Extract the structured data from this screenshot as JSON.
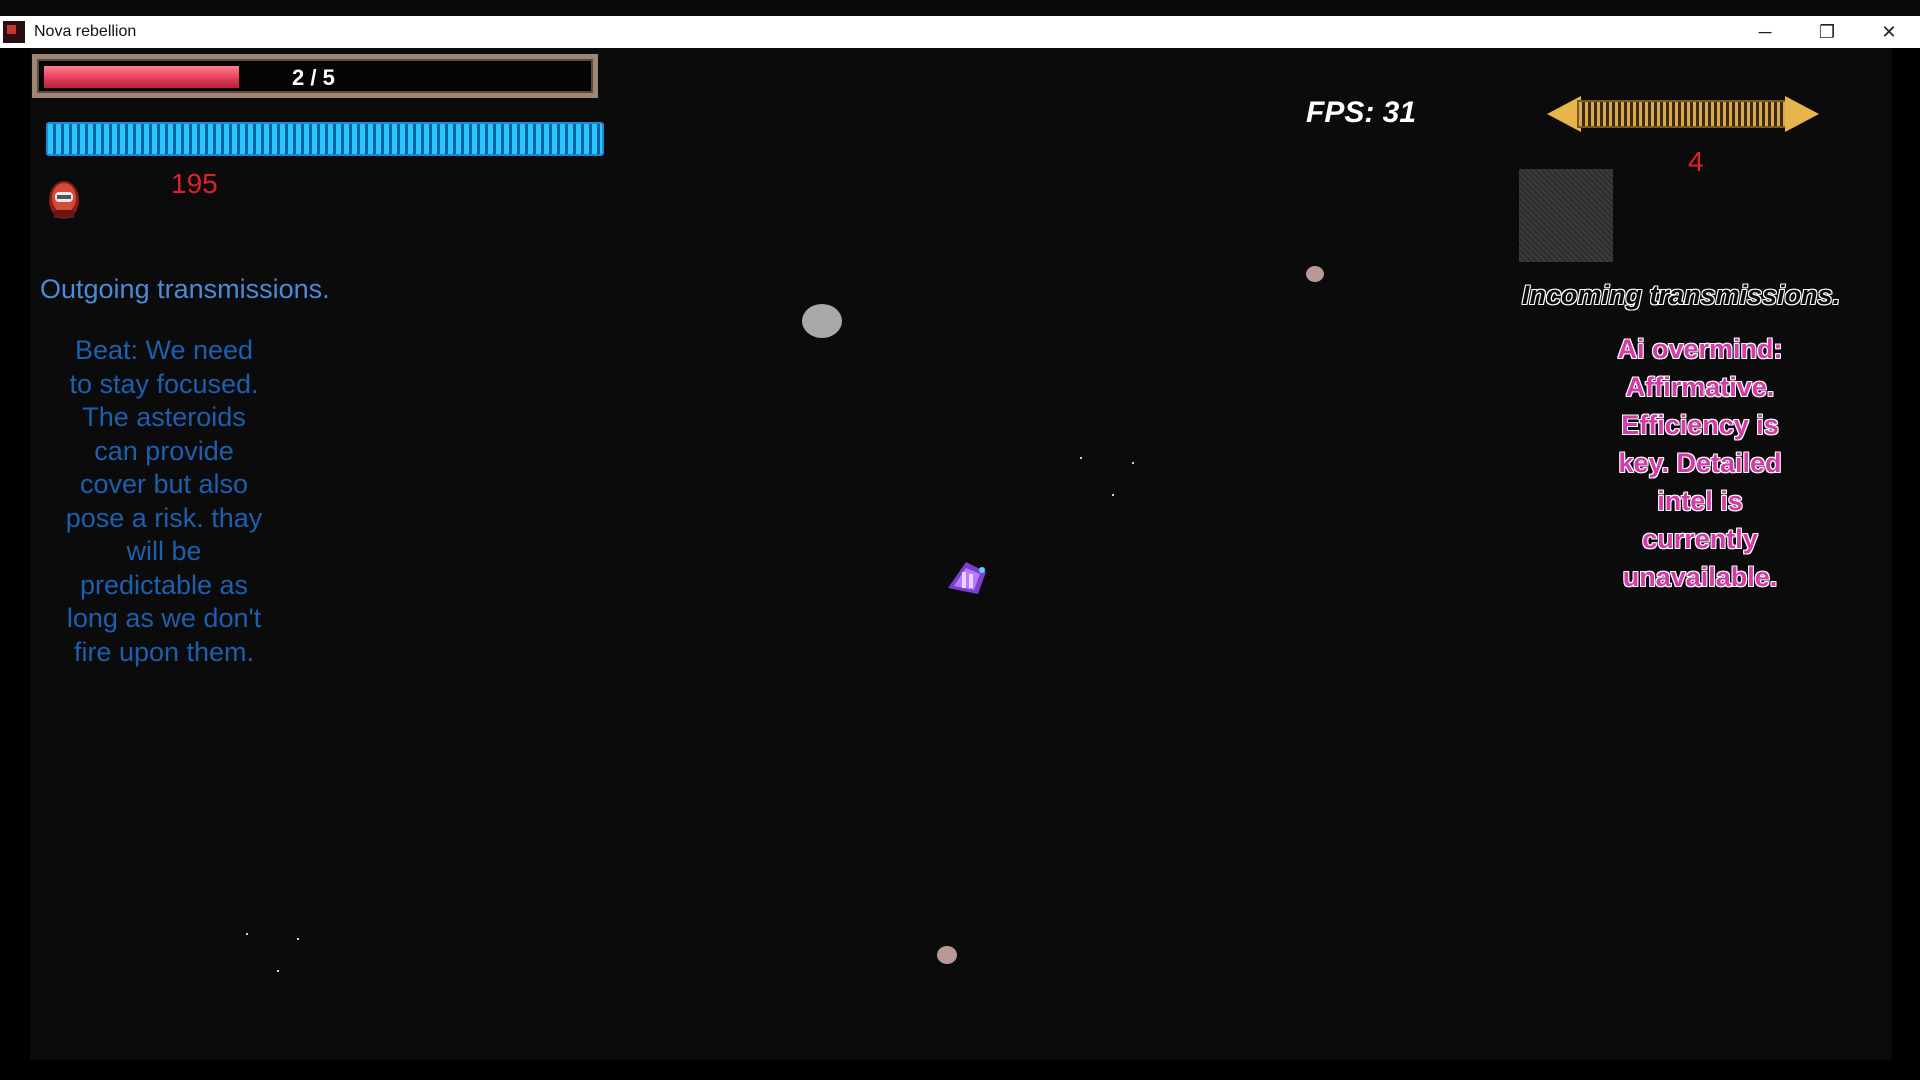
{
  "window": {
    "title": "Nova rebellion",
    "controls": [
      "minimize-icon",
      "restore-icon",
      "close-icon"
    ],
    "control_glyphs": {
      "minimize": "─",
      "restore": "❐",
      "close": "✕"
    }
  },
  "hud": {
    "health": {
      "label": "2 / 5",
      "current": 2,
      "max": 5,
      "color": "#e23a56"
    },
    "energy": {
      "fraction": 1.0,
      "color": "#29c5ff"
    },
    "score": "195",
    "fps": "FPS: 31",
    "level": "4"
  },
  "transmissions": {
    "outgoing": {
      "title": "Outgoing transmissions.",
      "message": "Beat: We need to stay focused. The asteroids can provide cover but also pose a risk. thay will be predictable as long as we don't fire upon them.",
      "color": "#1b5fae"
    },
    "incoming": {
      "title": "Incoming transmissions.",
      "message": "Ai overmind: Affirmative. Efficiency is key. Detailed intel is currently unavailable.",
      "color": "#d23ba8"
    }
  },
  "icons": {
    "player_avatar": "pilot-avatar-icon",
    "player_ship": "player-ship-icon"
  }
}
